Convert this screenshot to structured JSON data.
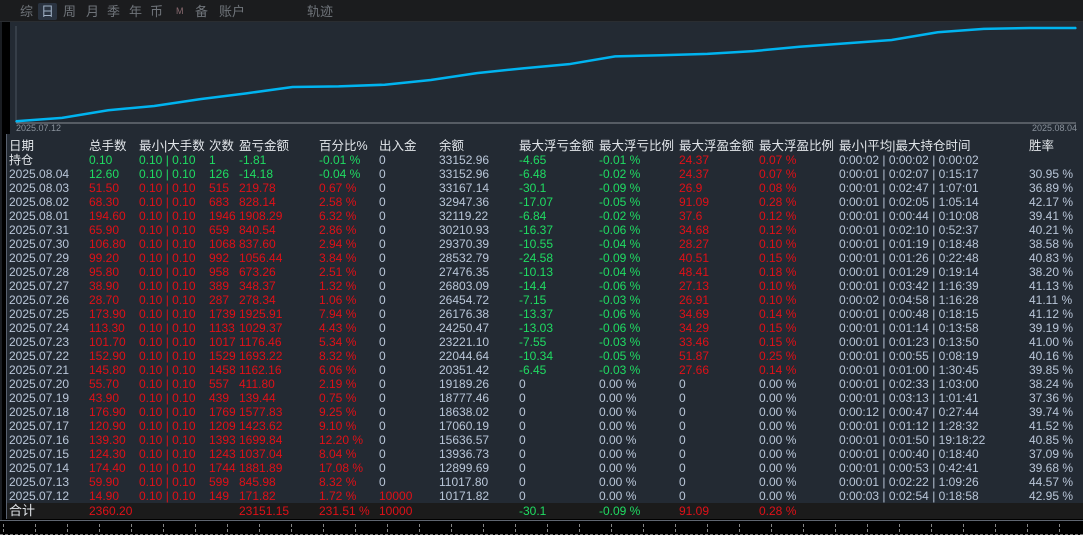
{
  "tabs": [
    {
      "label": "综"
    },
    {
      "label": "日",
      "active": true
    },
    {
      "label": "周"
    },
    {
      "label": "月"
    },
    {
      "label": "季"
    },
    {
      "label": "年"
    },
    {
      "label": "币"
    },
    {
      "label": "M"
    },
    {
      "label": "备"
    },
    {
      "label": "账户"
    },
    {
      "label": "轨迹"
    }
  ],
  "chart_data": {
    "type": "line",
    "title": "",
    "x_start_label": "2025.07.12",
    "x_end_label": "2025.08.04",
    "series": [
      {
        "name": "余额",
        "color": "#00b4f0",
        "x": [
          "2025.07.12",
          "2025.07.13",
          "2025.07.14",
          "2025.07.15",
          "2025.07.16",
          "2025.07.17",
          "2025.07.18",
          "2025.07.19",
          "2025.07.20",
          "2025.07.21",
          "2025.07.22",
          "2025.07.23",
          "2025.07.24",
          "2025.07.25",
          "2025.07.26",
          "2025.07.27",
          "2025.07.28",
          "2025.07.29",
          "2025.07.30",
          "2025.07.31",
          "2025.08.01",
          "2025.08.02",
          "2025.08.03",
          "2025.08.04"
        ],
        "values": [
          10171.82,
          11017.8,
          12899.69,
          13936.73,
          15636.57,
          17060.19,
          18638.02,
          18777.46,
          19189.26,
          20351.42,
          22044.64,
          23221.1,
          24250.47,
          26176.38,
          26454.72,
          26803.09,
          27476.35,
          28532.79,
          29370.39,
          30210.93,
          32119.22,
          32947.36,
          33167.14,
          33152.96
        ]
      }
    ]
  },
  "table": {
    "headers": [
      "日期",
      "总手数",
      "最小|大手数",
      "次数",
      "盈亏金额",
      "百分比%",
      "出入金",
      "余额",
      "最大浮亏金额",
      "最大浮亏比例",
      "最大浮盈金额",
      "最大浮盈比例",
      "最小|平均|最大持仓时间",
      "胜率"
    ],
    "rows": [
      [
        "持仓",
        "0.10",
        "0.10 | 0.10",
        "1",
        "-1.81",
        "-0.01 %",
        "0",
        "33152.96",
        "-4.65",
        "-0.01 %",
        "24.37",
        "0.07 %",
        "0:00:02 | 0:00:02 | 0:00:02",
        ""
      ],
      [
        "2025.08.04",
        "12.60",
        "0.10 | 0.10",
        "126",
        "-14.18",
        "-0.04 %",
        "0",
        "33152.96",
        "-6.48",
        "-0.02 %",
        "24.37",
        "0.07 %",
        "0:00:01 | 0:02:07 | 0:15:17",
        "30.95 %"
      ],
      [
        "2025.08.03",
        "51.50",
        "0.10 | 0.10",
        "515",
        "219.78",
        "0.67 %",
        "0",
        "33167.14",
        "-30.1",
        "-0.09 %",
        "26.9",
        "0.08 %",
        "0:00:01 | 0:02:47 | 1:07:01",
        "36.89 %"
      ],
      [
        "2025.08.02",
        "68.30",
        "0.10 | 0.10",
        "683",
        "828.14",
        "2.58 %",
        "0",
        "32947.36",
        "-17.07",
        "-0.05 %",
        "91.09",
        "0.28 %",
        "0:00:01 | 0:02:05 | 1:05:14",
        "42.17 %"
      ],
      [
        "2025.08.01",
        "194.60",
        "0.10 | 0.10",
        "1946",
        "1908.29",
        "6.32 %",
        "0",
        "32119.22",
        "-6.84",
        "-0.02 %",
        "37.6",
        "0.12 %",
        "0:00:01 | 0:00:44 | 0:10:08",
        "39.41 %"
      ],
      [
        "2025.07.31",
        "65.90",
        "0.10 | 0.10",
        "659",
        "840.54",
        "2.86 %",
        "0",
        "30210.93",
        "-16.37",
        "-0.06 %",
        "34.68",
        "0.12 %",
        "0:00:01 | 0:02:10 | 0:52:37",
        "40.21 %"
      ],
      [
        "2025.07.30",
        "106.80",
        "0.10 | 0.10",
        "1068",
        "837.60",
        "2.94 %",
        "0",
        "29370.39",
        "-10.55",
        "-0.04 %",
        "28.27",
        "0.10 %",
        "0:00:01 | 0:01:19 | 0:18:48",
        "38.58 %"
      ],
      [
        "2025.07.29",
        "99.20",
        "0.10 | 0.10",
        "992",
        "1056.44",
        "3.84 %",
        "0",
        "28532.79",
        "-24.58",
        "-0.09 %",
        "40.51",
        "0.15 %",
        "0:00:01 | 0:01:26 | 0:22:48",
        "40.83 %"
      ],
      [
        "2025.07.28",
        "95.80",
        "0.10 | 0.10",
        "958",
        "673.26",
        "2.51 %",
        "0",
        "27476.35",
        "-10.13",
        "-0.04 %",
        "48.41",
        "0.18 %",
        "0:00:01 | 0:01:29 | 0:19:14",
        "38.20 %"
      ],
      [
        "2025.07.27",
        "38.90",
        "0.10 | 0.10",
        "389",
        "348.37",
        "1.32 %",
        "0",
        "26803.09",
        "-14.4",
        "-0.06 %",
        "27.13",
        "0.10 %",
        "0:00:01 | 0:03:42 | 1:16:39",
        "41.13 %"
      ],
      [
        "2025.07.26",
        "28.70",
        "0.10 | 0.10",
        "287",
        "278.34",
        "1.06 %",
        "0",
        "26454.72",
        "-7.15",
        "-0.03 %",
        "26.91",
        "0.10 %",
        "0:00:02 | 0:04:58 | 1:16:28",
        "41.11 %"
      ],
      [
        "2025.07.25",
        "173.90",
        "0.10 | 0.10",
        "1739",
        "1925.91",
        "7.94 %",
        "0",
        "26176.38",
        "-13.37",
        "-0.06 %",
        "34.69",
        "0.14 %",
        "0:00:01 | 0:00:48 | 0:18:15",
        "41.12 %"
      ],
      [
        "2025.07.24",
        "113.30",
        "0.10 | 0.10",
        "1133",
        "1029.37",
        "4.43 %",
        "0",
        "24250.47",
        "-13.03",
        "-0.06 %",
        "34.29",
        "0.15 %",
        "0:00:01 | 0:01:14 | 0:13:58",
        "39.19 %"
      ],
      [
        "2025.07.23",
        "101.70",
        "0.10 | 0.10",
        "1017",
        "1176.46",
        "5.34 %",
        "0",
        "23221.10",
        "-7.55",
        "-0.03 %",
        "33.46",
        "0.15 %",
        "0:00:01 | 0:01:23 | 0:13:50",
        "41.00 %"
      ],
      [
        "2025.07.22",
        "152.90",
        "0.10 | 0.10",
        "1529",
        "1693.22",
        "8.32 %",
        "0",
        "22044.64",
        "-10.34",
        "-0.05 %",
        "51.87",
        "0.25 %",
        "0:00:01 | 0:00:55 | 0:08:19",
        "40.16 %"
      ],
      [
        "2025.07.21",
        "145.80",
        "0.10 | 0.10",
        "1458",
        "1162.16",
        "6.06 %",
        "0",
        "20351.42",
        "-6.45",
        "-0.03 %",
        "27.66",
        "0.14 %",
        "0:00:01 | 0:01:00 | 1:30:45",
        "39.85 %"
      ],
      [
        "2025.07.20",
        "55.70",
        "0.10 | 0.10",
        "557",
        "411.80",
        "2.19 %",
        "0",
        "19189.26",
        "0",
        "0.00 %",
        "0",
        "0.00 %",
        "0:00:01 | 0:02:33 | 1:03:00",
        "38.24 %"
      ],
      [
        "2025.07.19",
        "43.90",
        "0.10 | 0.10",
        "439",
        "139.44",
        "0.75 %",
        "0",
        "18777.46",
        "0",
        "0.00 %",
        "0",
        "0.00 %",
        "0:00:01 | 0:03:13 | 1:01:41",
        "37.36 %"
      ],
      [
        "2025.07.18",
        "176.90",
        "0.10 | 0.10",
        "1769",
        "1577.83",
        "9.25 %",
        "0",
        "18638.02",
        "0",
        "0.00 %",
        "0",
        "0.00 %",
        "0:00:12 | 0:00:47 | 0:27:44",
        "39.74 %"
      ],
      [
        "2025.07.17",
        "120.90",
        "0.10 | 0.10",
        "1209",
        "1423.62",
        "9.10 %",
        "0",
        "17060.19",
        "0",
        "0.00 %",
        "0",
        "0.00 %",
        "0:00:01 | 0:01:12 | 1:28:32",
        "41.52 %"
      ],
      [
        "2025.07.16",
        "139.30",
        "0.10 | 0.10",
        "1393",
        "1699.84",
        "12.20 %",
        "0",
        "15636.57",
        "0",
        "0.00 %",
        "0",
        "0.00 %",
        "0:00:01 | 0:01:50 | 19:18:22",
        "40.85 %"
      ],
      [
        "2025.07.15",
        "124.30",
        "0.10 | 0.10",
        "1243",
        "1037.04",
        "8.04 %",
        "0",
        "13936.73",
        "0",
        "0.00 %",
        "0",
        "0.00 %",
        "0:00:01 | 0:00:40 | 0:18:40",
        "37.09 %"
      ],
      [
        "2025.07.14",
        "174.40",
        "0.10 | 0.10",
        "1744",
        "1881.89",
        "17.08 %",
        "0",
        "12899.69",
        "0",
        "0.00 %",
        "0",
        "0.00 %",
        "0:00:01 | 0:00:53 | 0:42:41",
        "39.68 %"
      ],
      [
        "2025.07.13",
        "59.90",
        "0.10 | 0.10",
        "599",
        "845.98",
        "8.32 %",
        "0",
        "11017.80",
        "0",
        "0.00 %",
        "0",
        "0.00 %",
        "0:00:01 | 0:02:22 | 1:09:26",
        "44.57 %"
      ],
      [
        "2025.07.12",
        "14.90",
        "0.10 | 0.10",
        "149",
        "171.82",
        "1.72 %",
        "10000",
        "10171.82",
        "0",
        "0.00 %",
        "0",
        "0.00 %",
        "0:00:03 | 0:02:54 | 0:18:58",
        "42.95 %"
      ]
    ],
    "total": [
      "合计",
      "2360.20",
      "",
      "",
      "23151.15",
      "231.51 %",
      "10000",
      "",
      "-30.1",
      "-0.09 %",
      "91.09",
      "0.28 %",
      "",
      ""
    ]
  },
  "colors": {
    "profit": "#e01017",
    "loss": "#1fdc62",
    "line": "#00b4f0",
    "neutral": "#b9c6d8"
  }
}
